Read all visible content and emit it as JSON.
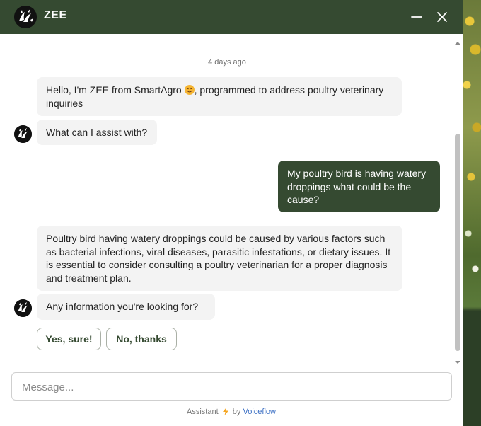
{
  "header": {
    "title": "ZEE"
  },
  "chat": {
    "timestamp": "4 days ago",
    "messages": [
      {
        "from": "bot",
        "text_before_emoji": "Hello, I'm ZEE from SmartAgro",
        "text_after_emoji": ", programmed to address poultry veterinary inquiries"
      },
      {
        "from": "bot",
        "text": "What can I assist with?"
      },
      {
        "from": "user",
        "text": "My poultry bird is having watery droppings what could be the cause?"
      },
      {
        "from": "bot",
        "text": "Poultry bird having watery droppings could be caused by various factors such as bacterial infections, viral diseases, parasitic infestations, or dietary issues. It is essential to consider consulting a poultry veterinarian for a proper diagnosis and treatment plan."
      },
      {
        "from": "bot",
        "text": "Any information you're looking for?"
      }
    ],
    "choices": [
      "Yes, sure!",
      "No, thanks"
    ]
  },
  "composer": {
    "placeholder": "Message..."
  },
  "footer": {
    "prefix": "Assistant",
    "by": "by",
    "brand": "Voiceflow"
  },
  "colors": {
    "header_bg": "#354a31",
    "user_bubble": "#354a31",
    "bot_bubble": "#f3f3f3",
    "bolt": "#f5a623",
    "link": "#3b6fc4"
  },
  "icons": {
    "avatar": "bird-logo-icon",
    "minimize": "minimize-icon",
    "close": "close-icon",
    "emoji": "smiling-face-emoji",
    "bolt": "lightning-bolt-icon"
  }
}
